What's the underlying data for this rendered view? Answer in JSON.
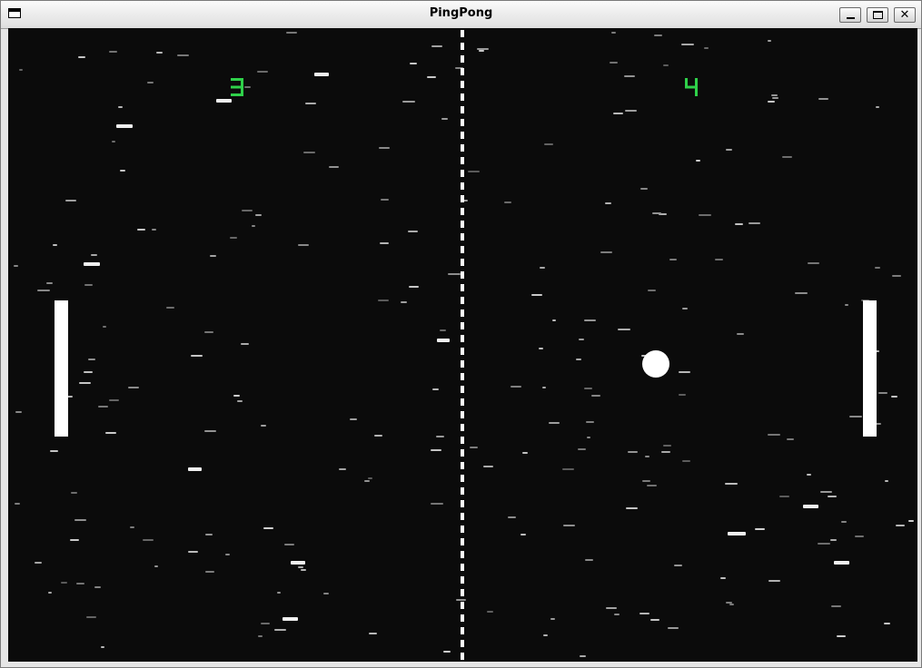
{
  "window": {
    "title": "PingPong",
    "icon": "app-window-icon",
    "buttons": [
      "minimize-icon",
      "maximize-icon",
      "close-icon"
    ]
  },
  "game": {
    "background": "#0b0b0b",
    "score_color": "#2fd14a",
    "left_score": 3,
    "right_score": 4,
    "net": "dashed-center-line",
    "left_paddle": "white-bar",
    "right_paddle": "white-bar",
    "ball": "white-circle"
  }
}
